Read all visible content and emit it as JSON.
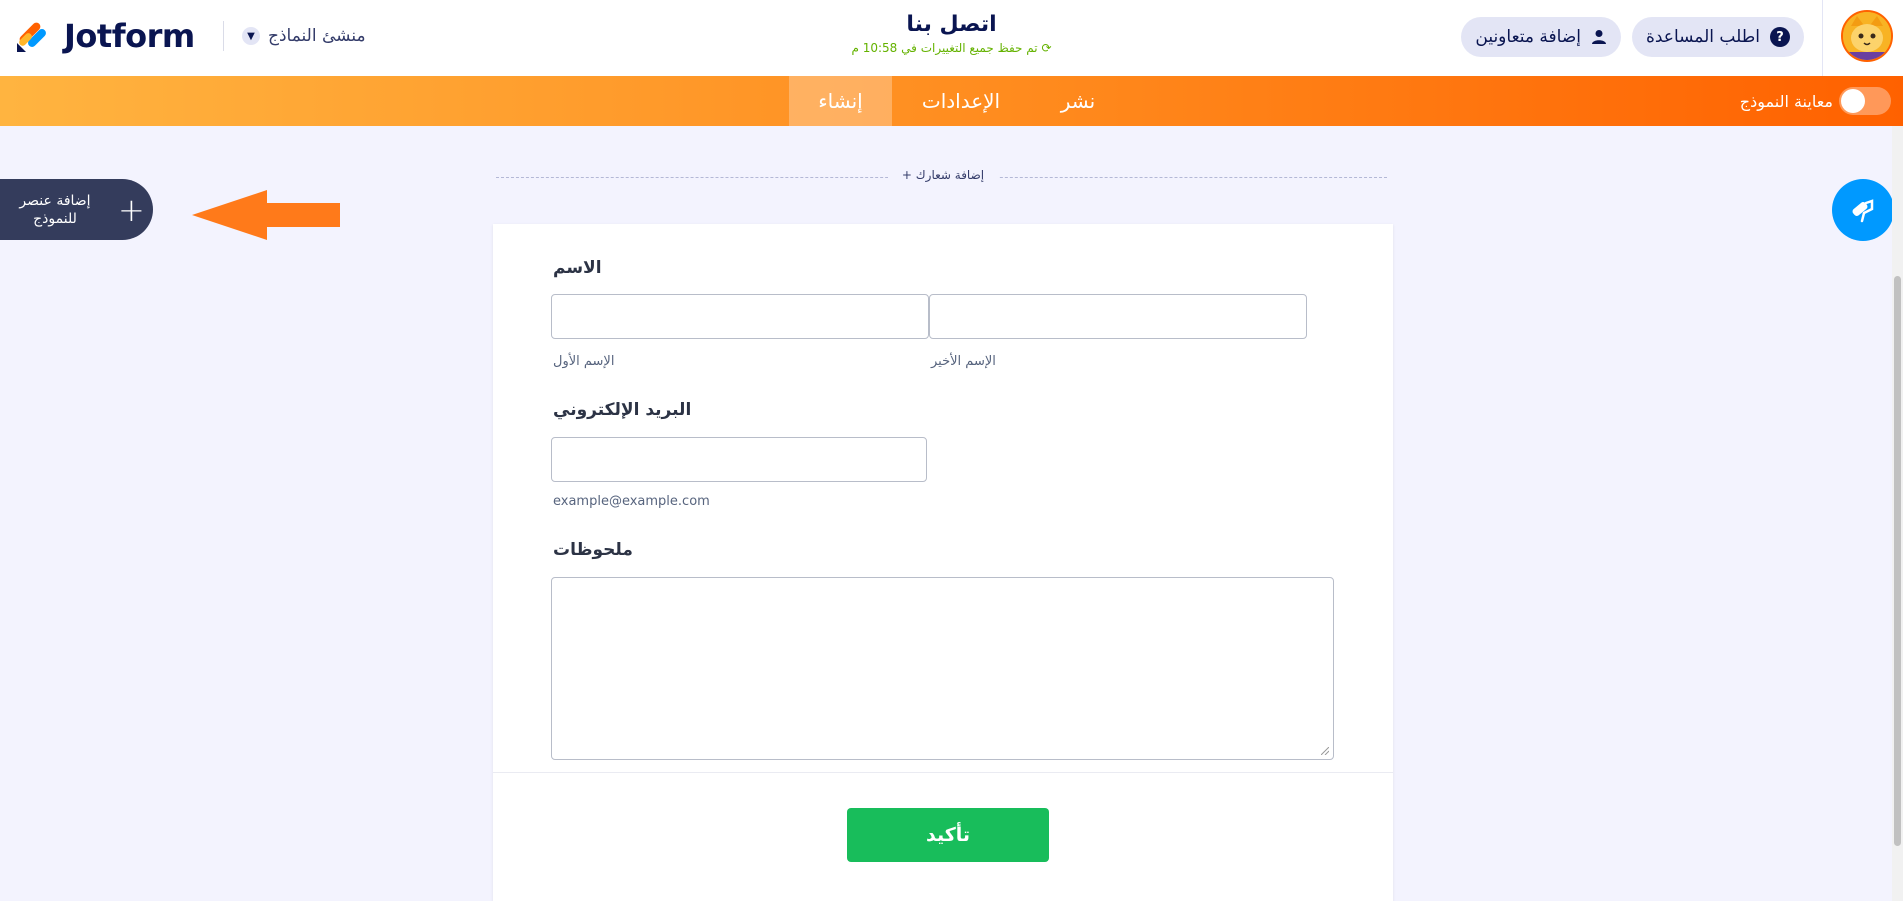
{
  "header": {
    "logo_text": "Jotform",
    "builder_label": "منشئ النماذج",
    "form_title": "اتصل بنا",
    "saved_status": "تم حفظ جميع التغييرات في 10:58 م",
    "help_label": "اطلب المساعدة",
    "help_icon_text": "?",
    "collab_label": "إضافة متعاونين"
  },
  "nav": {
    "tabs": [
      {
        "label": "إنشاء",
        "active": true
      },
      {
        "label": "الإعدادات",
        "active": false
      },
      {
        "label": "نشر",
        "active": false
      }
    ],
    "preview_label": "معاينة النموذج",
    "preview_on": false
  },
  "builder": {
    "add_element_label": "إضافة عنصر للنموذج",
    "add_logo_label": "إضافة شعارك +"
  },
  "form": {
    "name_label": "الاسم",
    "first_name_sub": "الإسم الأول",
    "last_name_sub": "الإسم الأخير",
    "email_label": "البريد الإلكتروني",
    "email_sub": "example@example.com",
    "notes_label": "ملحوظات",
    "submit_label": "تأكيد"
  },
  "colors": {
    "accent_orange": "#ff6100",
    "submit_green": "#18bd5b",
    "paint_blue": "#0099ff",
    "navy": "#0a1551"
  }
}
